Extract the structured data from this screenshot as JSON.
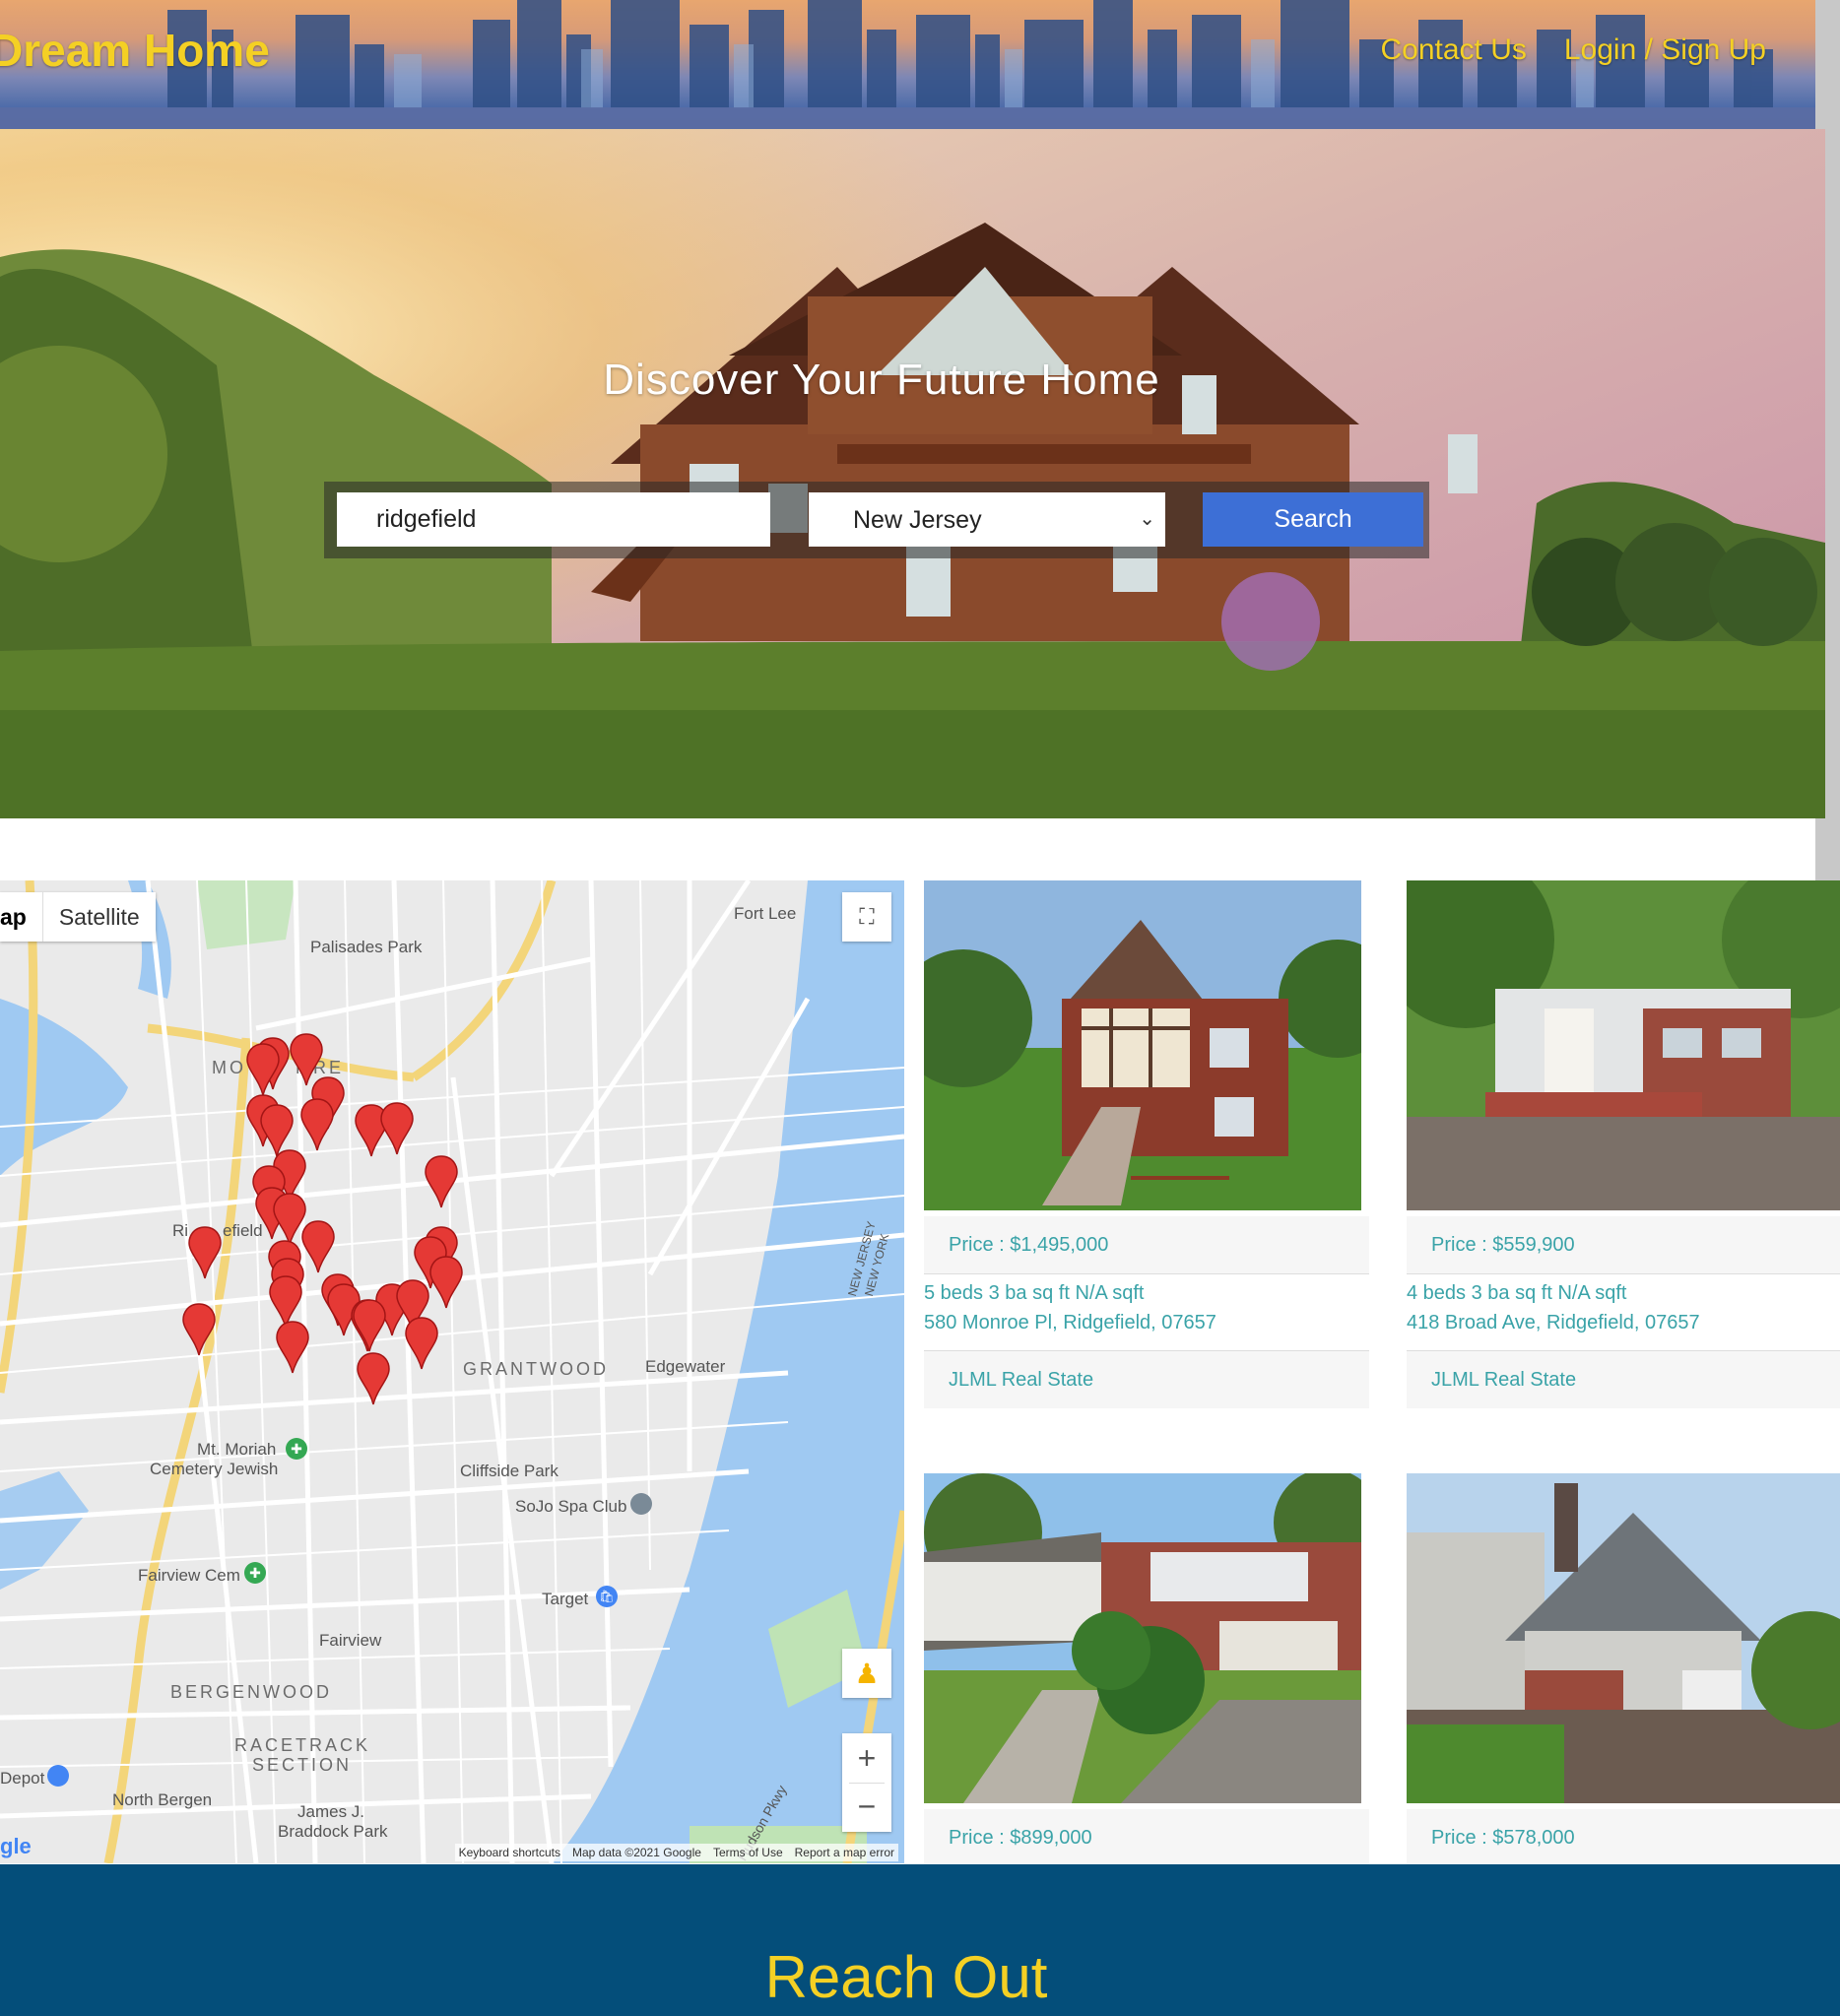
{
  "header": {
    "logo": "Dream Home",
    "nav": [
      "Contact Us",
      "Login / Sign Up"
    ]
  },
  "hero": {
    "title": "Discover Your Future Home",
    "search": {
      "query_value": "ridgefield",
      "state_selected": "New Jersey",
      "button_label": "Search"
    }
  },
  "map": {
    "type_buttons": [
      "ap",
      "Satellite"
    ],
    "labels": {
      "palisades_park": "Palisades Park",
      "fort_lee": "Fort Lee",
      "moonachie": "MO",
      "moonachie2": "MRE",
      "ridgefield": "Ri",
      "ridgefield2": "efield",
      "grantwood": "GRANTWOOD",
      "edgewater": "Edgewater",
      "cliffside_park": "Cliffside Park",
      "sojo": "SoJo Spa Club",
      "mt_moriah": "Mt. Moriah",
      "cemetery": "Cemetery Jewish",
      "fairview_cem": "Fairview Cem",
      "target": "Target",
      "fairview": "Fairview",
      "bergenwood": "BERGENWOOD",
      "racetrack": "RACETRACK",
      "section": "SECTION",
      "north_bergen": "North Bergen",
      "james": "James J.",
      "braddock": "Braddock Park",
      "depot": "Depot",
      "new_jersey": "NEW JERSEY",
      "new_york": "NEW YORK",
      "hudson": "Hudson Pkwy",
      "gle": "gle"
    },
    "footer": [
      "Keyboard shortcuts",
      "Map data ©2021 Google",
      "Terms of Use",
      "Report a map error"
    ]
  },
  "listings": [
    {
      "price": "Price : $1,495,000",
      "specs": "5 beds 3 ba sq ft N/A sqft",
      "address": "580 Monroe Pl, Ridgefield, 07657",
      "agency": "JLML Real State"
    },
    {
      "price": "Price : $559,900",
      "specs": "4 beds 3 ba sq ft N/A sqft",
      "address": "418 Broad Ave, Ridgefield, 07657",
      "agency": "JLML Real State"
    },
    {
      "price": "Price : $899,000"
    },
    {
      "price": "Price : $578,000"
    }
  ],
  "reach": {
    "title": "Reach Out"
  },
  "colors": {
    "accent_yellow": "#f4d024",
    "teal_text": "#3aa3a8",
    "search_blue": "#3d6fd6",
    "footer_blue": "#044e7a",
    "marker_red": "#e53935"
  }
}
